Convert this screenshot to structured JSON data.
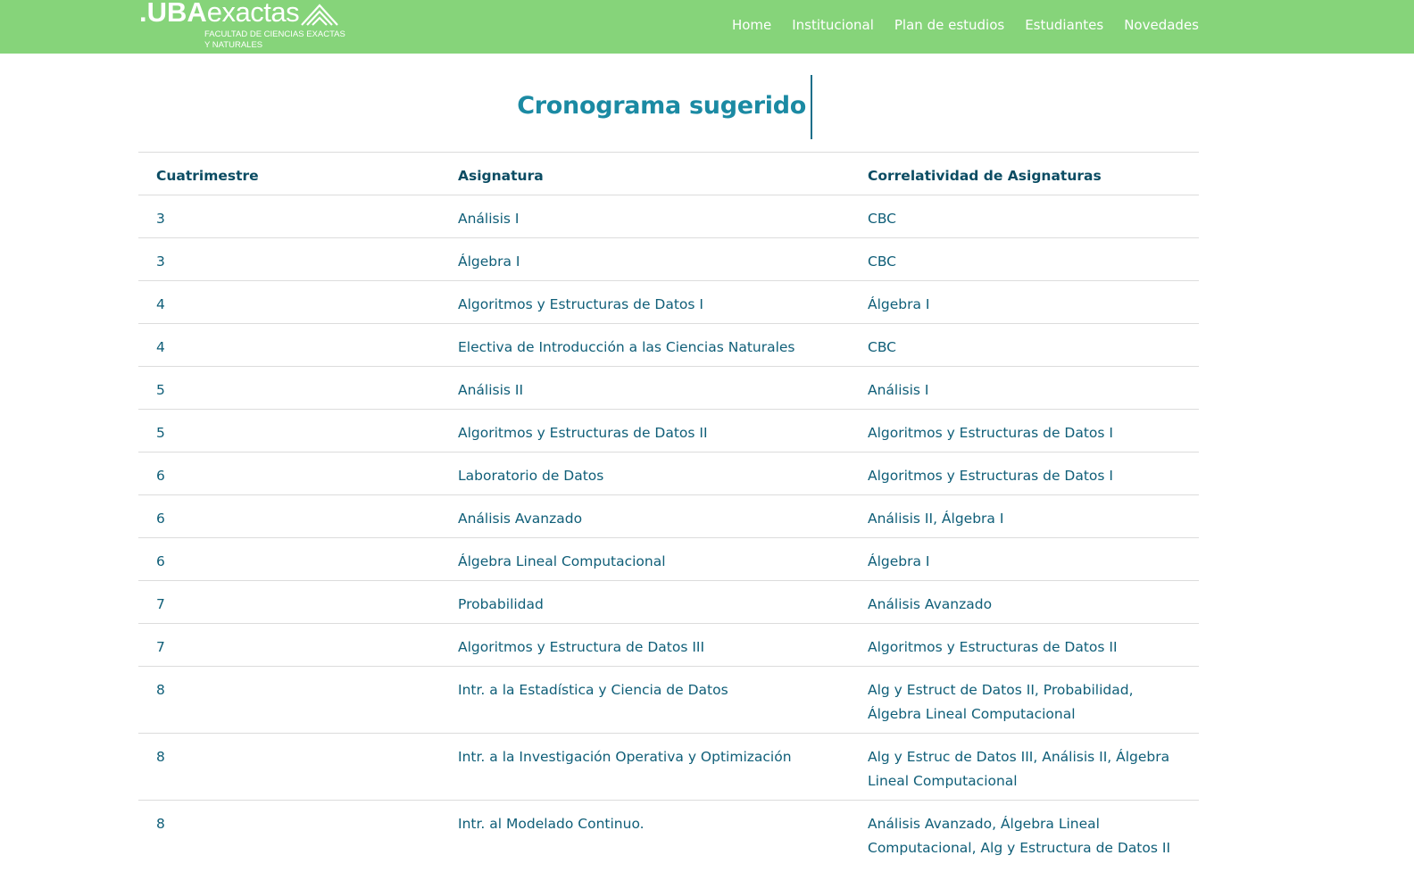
{
  "header": {
    "logo": {
      "prefix": ".UBA",
      "name": "exactas",
      "subtitle_line1": "FACULTAD DE CIENCIAS EXACTAS",
      "subtitle_line2": "Y NATURALES"
    },
    "nav": [
      "Home",
      "Institucional",
      "Plan de estudios",
      "Estudiantes",
      "Novedades"
    ],
    "background_color": "#86d47a"
  },
  "main": {
    "title": "Cronograma sugerido",
    "table": {
      "headers": [
        "Cuatrimestre",
        "Asignatura",
        "Correlatividad de Asignaturas"
      ],
      "rows": [
        {
          "cuatrimestre": "3",
          "asignatura": "Análisis I",
          "correlatividad": "CBC"
        },
        {
          "cuatrimestre": "3",
          "asignatura": "Álgebra I",
          "correlatividad": "CBC"
        },
        {
          "cuatrimestre": "4",
          "asignatura": "Algoritmos y Estructuras de Datos I",
          "correlatividad": "Álgebra I"
        },
        {
          "cuatrimestre": "4",
          "asignatura": "Electiva de Introducción a las Ciencias Naturales",
          "correlatividad": "CBC"
        },
        {
          "cuatrimestre": "5",
          "asignatura": "Análisis II",
          "correlatividad": "Análisis I"
        },
        {
          "cuatrimestre": "5",
          "asignatura": "Algoritmos y Estructuras de Datos II",
          "correlatividad": "Algoritmos y Estructuras de Datos I"
        },
        {
          "cuatrimestre": "6",
          "asignatura": "Laboratorio de Datos",
          "correlatividad": "Algoritmos y Estructuras de Datos I"
        },
        {
          "cuatrimestre": "6",
          "asignatura": "Análisis Avanzado",
          "correlatividad": "Análisis II, Álgebra I"
        },
        {
          "cuatrimestre": "6",
          "asignatura": "Álgebra Lineal Computacional",
          "correlatividad": "Álgebra I"
        },
        {
          "cuatrimestre": "7",
          "asignatura": "Probabilidad",
          "correlatividad": "Análisis Avanzado"
        },
        {
          "cuatrimestre": "7",
          "asignatura": "Algoritmos y Estructura de Datos III",
          "correlatividad": "Algoritmos y Estructuras de Datos II"
        },
        {
          "cuatrimestre": "8",
          "asignatura": "Intr. a la Estadística y Ciencia de Datos",
          "correlatividad": "Alg y Estruct de Datos II, Probabilidad, Álgebra Lineal Computacional"
        },
        {
          "cuatrimestre": "8",
          "asignatura": "Intr. a la Investigación Operativa y Optimización",
          "correlatividad": "Alg y Estruc de Datos III, Análisis II, Álgebra Lineal Computacional"
        },
        {
          "cuatrimestre": "8",
          "asignatura": "Intr. al Modelado Continuo.",
          "correlatividad": "Análisis Avanzado, Álgebra Lineal Computacional, Alg y Estructura de Datos II"
        }
      ]
    }
  }
}
